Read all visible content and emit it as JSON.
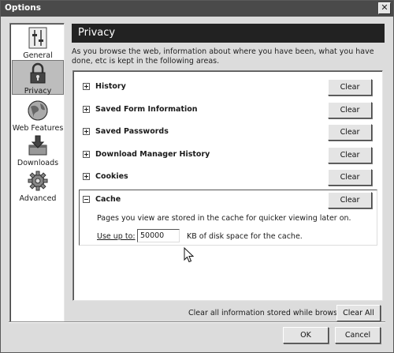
{
  "window": {
    "title": "Options",
    "close_glyph": "✕"
  },
  "sidebar": {
    "items": [
      {
        "label": "General",
        "icon": "general-icon"
      },
      {
        "label": "Privacy",
        "icon": "lock-icon",
        "selected": true
      },
      {
        "label": "Web Features",
        "icon": "globe-icon"
      },
      {
        "label": "Downloads",
        "icon": "downloads-icon"
      },
      {
        "label": "Advanced",
        "icon": "gear-icon"
      }
    ]
  },
  "header": {
    "title": "Privacy"
  },
  "intro": "As you browse the web, information about where you have been, what you have done, etc is kept in the following areas.",
  "sections": [
    {
      "label": "History",
      "button": "Clear",
      "expanded": false
    },
    {
      "label": "Saved Form Information",
      "button": "Clear",
      "expanded": false
    },
    {
      "label": "Saved Passwords",
      "button": "Clear",
      "expanded": false
    },
    {
      "label": "Download Manager History",
      "button": "Clear",
      "expanded": false
    },
    {
      "label": "Cookies",
      "button": "Clear",
      "expanded": false
    }
  ],
  "cache": {
    "label": "Cache",
    "button": "Clear",
    "expanded": true,
    "description": "Pages you view are stored in the cache for quicker viewing later on.",
    "use_up_to_label": "Use up to:",
    "kb_value": "50000",
    "kb_suffix": "KB of disk space for the cache."
  },
  "footer": {
    "clear_all_text": "Clear all information stored while browsing:",
    "clear_all_button": "Clear All",
    "ok_button": "OK",
    "cancel_button": "Cancel"
  }
}
